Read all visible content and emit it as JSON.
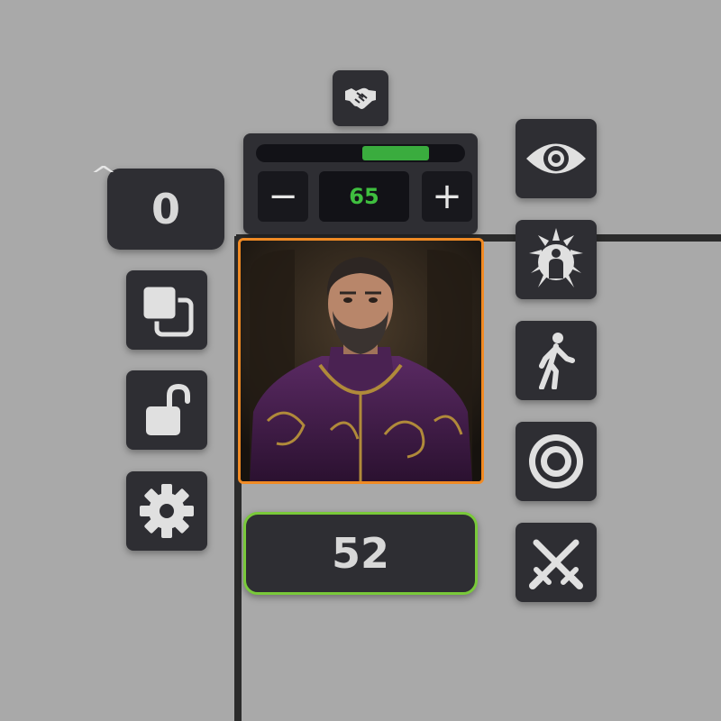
{
  "token": {
    "initiative": "0",
    "hp": {
      "value": "65",
      "decrease_label": "−",
      "increase_label": "+",
      "bar_fill_fraction": 0.32,
      "bar_start_fraction": 0.51,
      "bar_color": "#3aac3e"
    },
    "stat_value": "52",
    "portrait_border_color": "#f08a24",
    "stat_border_color": "#79c93a"
  },
  "left_toolbar": {
    "expand_icon": "chevron-up-icon",
    "buttons": [
      "duplicate-icon",
      "unlock-icon",
      "gear-icon"
    ]
  },
  "top_button": "handshake-icon",
  "right_toolbar": {
    "buttons": [
      "eye-icon",
      "aura-icon",
      "walk-icon",
      "target-icon",
      "crossed-swords-icon"
    ]
  }
}
